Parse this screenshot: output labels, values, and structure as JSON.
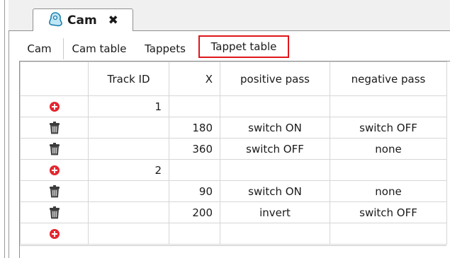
{
  "doc_tab": {
    "title": "Cam",
    "close_label": "✖",
    "icon": "cam-icon"
  },
  "sub_tabs": [
    {
      "label": "Cam"
    },
    {
      "label": "Cam table"
    },
    {
      "label": "Tappets"
    },
    {
      "label": "Tappet table",
      "active": true
    }
  ],
  "table": {
    "headers": {
      "icon": "",
      "track_id": "Track ID",
      "x": "X",
      "positive_pass": "positive pass",
      "negative_pass": "negative pass"
    },
    "rows": [
      {
        "icon": "add-icon",
        "track_id": "1",
        "x": "",
        "positive_pass": "",
        "negative_pass": ""
      },
      {
        "icon": "trash-icon",
        "track_id": "",
        "x": "180",
        "positive_pass": "switch ON",
        "negative_pass": "switch OFF"
      },
      {
        "icon": "trash-icon",
        "track_id": "",
        "x": "360",
        "positive_pass": "switch OFF",
        "negative_pass": "none"
      },
      {
        "icon": "add-icon",
        "track_id": "2",
        "x": "",
        "positive_pass": "",
        "negative_pass": ""
      },
      {
        "icon": "trash-icon",
        "track_id": "",
        "x": "90",
        "positive_pass": "switch ON",
        "negative_pass": "none"
      },
      {
        "icon": "trash-icon",
        "track_id": "",
        "x": "200",
        "positive_pass": "invert",
        "negative_pass": "switch OFF"
      },
      {
        "icon": "add-icon",
        "track_id": "",
        "x": "",
        "positive_pass": "",
        "negative_pass": ""
      }
    ]
  },
  "colors": {
    "highlight_border": "#e0161b",
    "add_icon": "#e3262f",
    "cam_icon": "#2aa7d6"
  }
}
